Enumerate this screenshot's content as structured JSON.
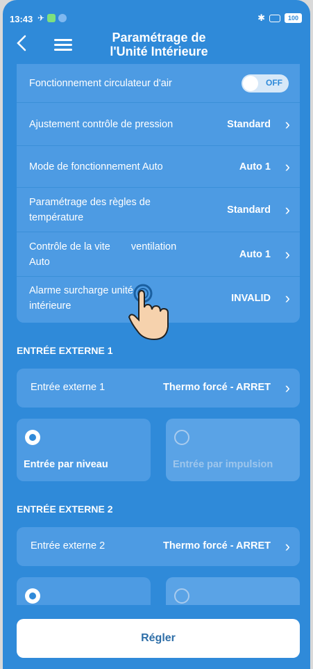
{
  "status": {
    "time": "13:43",
    "battery": "100"
  },
  "header": {
    "title_line1": "Paramétrage de",
    "title_line2": "l'Unité Intérieure"
  },
  "settings": {
    "air_circulator": {
      "label": "Fonctionnement circulateur d'air",
      "toggle": "OFF"
    },
    "rows": [
      {
        "label": "Ajustement contrôle de pression",
        "value": "Standard"
      },
      {
        "label": "Mode de fonctionnement Auto",
        "value": "Auto 1"
      },
      {
        "label": "Paramétrage des règles de température",
        "value": "Standard"
      },
      {
        "label": "Contrôle de la vite",
        "label_tail": "ventilation",
        "label_line2": "Auto",
        "value": "Auto 1"
      },
      {
        "label": "Alarme surcharge unité intérieure",
        "value": "INVALID"
      }
    ]
  },
  "ext1": {
    "section": "ENTRÉE EXTERNE 1",
    "label": "Entrée externe 1",
    "value": "Thermo forcé - ARRET",
    "options": [
      "Entrée par niveau",
      "Entrée par impulsion"
    ]
  },
  "ext2": {
    "section": "ENTRÉE EXTERNE 2",
    "label": "Entrée externe 2",
    "value": "Thermo forcé - ARRET"
  },
  "action": {
    "apply": "Régler"
  },
  "colors": {
    "background": "#2f8ad9",
    "card": "#4d9be3",
    "button": "#ffffff"
  },
  "icons": [
    "back-chevron-icon",
    "hamburger-menu-icon",
    "chevron-right-icon",
    "pointing-hand-icon",
    "bluetooth-icon",
    "battery-icon"
  ]
}
